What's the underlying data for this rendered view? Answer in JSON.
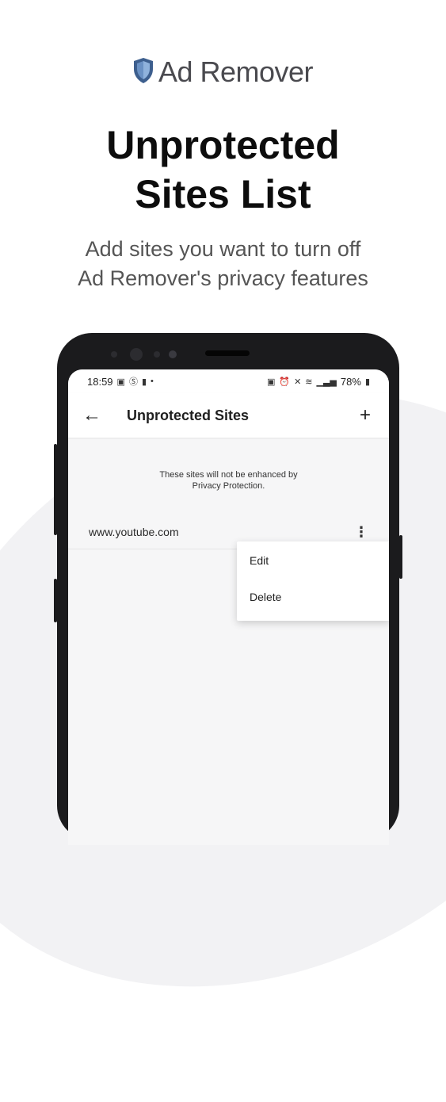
{
  "brand": {
    "name": "Ad Remover",
    "icon": "shield-icon"
  },
  "headline": {
    "line1": "Unprotected",
    "line2": "Sites List"
  },
  "subtitle": {
    "line1": "Add sites you want to turn off",
    "line2": "Ad Remover's privacy features"
  },
  "status_bar": {
    "time": "18:59",
    "battery": "78%"
  },
  "app_bar": {
    "title": "Unprotected Sites",
    "back_icon": "←",
    "add_icon": "+"
  },
  "notice": {
    "line1": "These sites will not be enhanced by",
    "line2": "Privacy Protection."
  },
  "sites": [
    {
      "url": "www.youtube.com",
      "more_icon": "⋮"
    }
  ],
  "menu": {
    "edit": "Edit",
    "delete": "Delete"
  },
  "colors": {
    "shield": "#4a6fa5",
    "brand_text": "#4a4a4f"
  }
}
